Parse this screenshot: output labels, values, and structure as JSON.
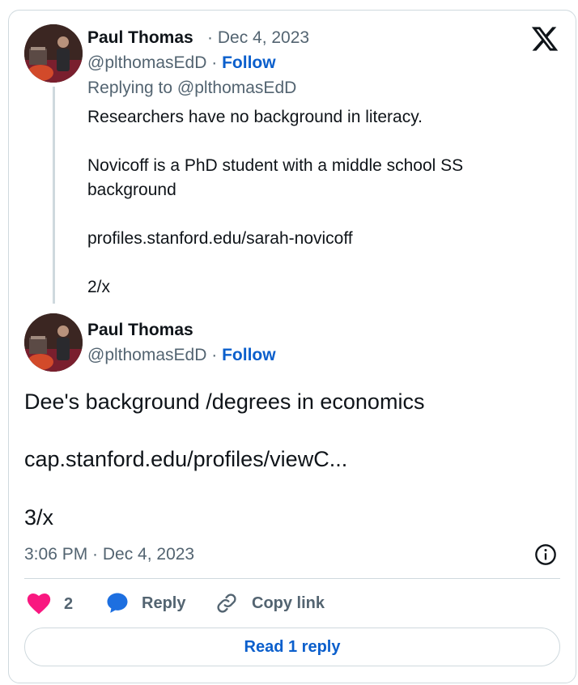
{
  "tweet1": {
    "author_name": "Paul Thomas",
    "separator": "·",
    "date": "Dec 4, 2023",
    "handle": "@plthomasEdD",
    "follow_label": "Follow",
    "replying_prefix": "Replying to ",
    "replying_handle": "@plthomasEdD",
    "line1": "Researchers have no background in literacy.",
    "line2": "Novicoff is a PhD student with a middle school SS",
    "line3": "background",
    "link": "profiles.stanford.edu/sarah-novicoff",
    "line4": "2/x"
  },
  "tweet2": {
    "author_name": "Paul Thomas",
    "handle": "@plthomasEdD",
    "follow_label": "Follow",
    "line1": "Dee's background /degrees in economics",
    "link": "cap.stanford.edu/profiles/viewC...",
    "line2": "3/x",
    "timestamp": "3:06 PM · Dec 4, 2023"
  },
  "actions": {
    "like_count": "2",
    "reply_label": "Reply",
    "copy_link_label": "Copy link",
    "read_replies_label": "Read 1 reply"
  },
  "icons": {
    "brand": "x-logo-icon",
    "info": "info-icon",
    "like": "heart-icon",
    "reply": "speech-bubble-icon",
    "copy": "link-icon"
  },
  "colors": {
    "link": "#0b5fcc",
    "like": "#f91880",
    "reply": "#1d6fe0",
    "muted": "#536471",
    "border": "#cfd9de"
  }
}
